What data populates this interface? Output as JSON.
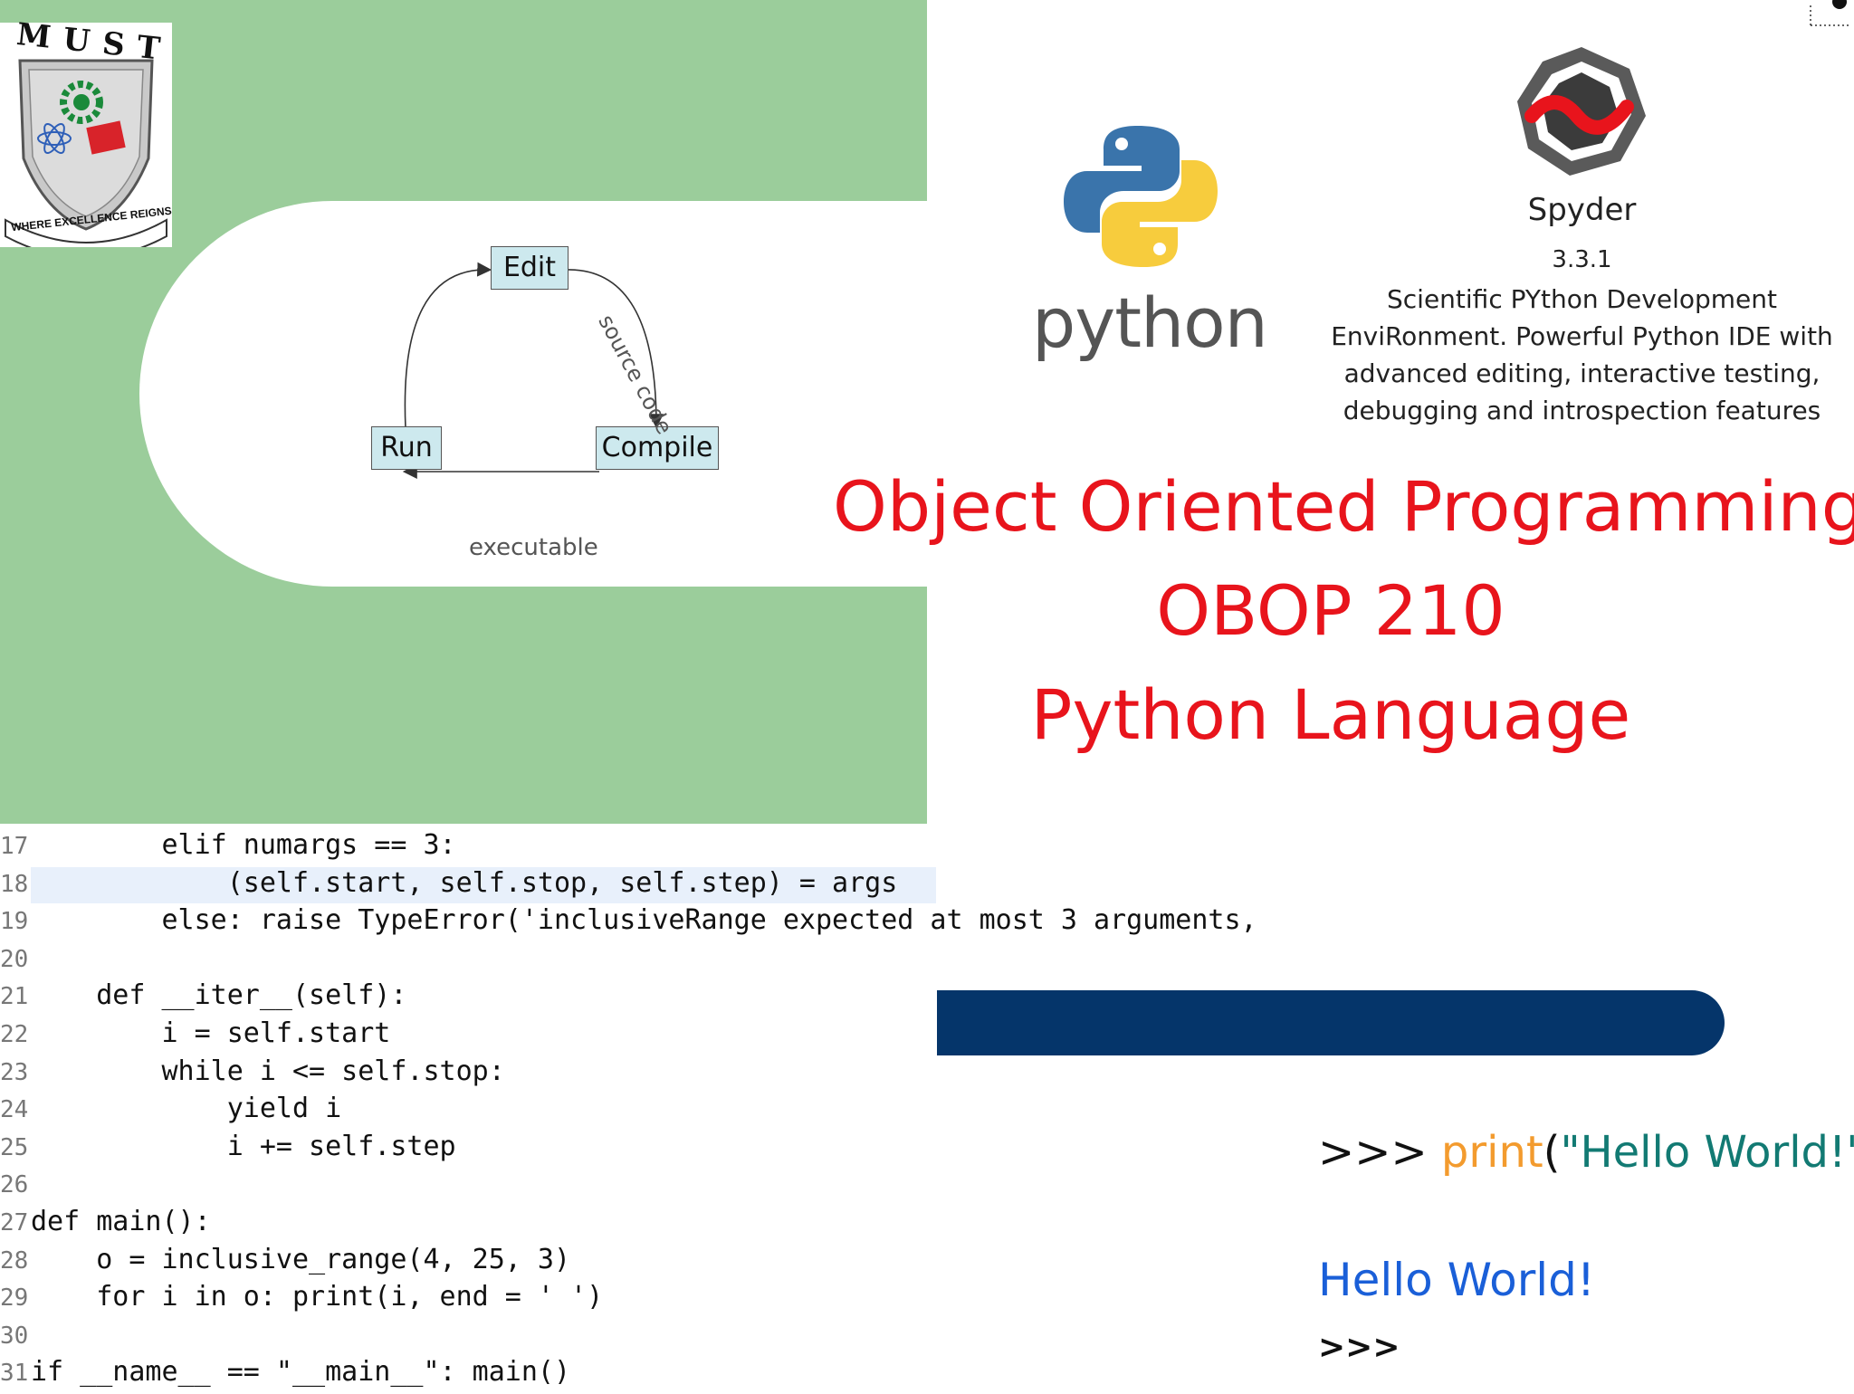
{
  "logo": {
    "name": "MUST",
    "motto": "WHERE EXCELLENCE REIGNS"
  },
  "diagram": {
    "nodes": {
      "edit": "Edit",
      "run": "Run",
      "compile": "Compile"
    },
    "edge_edit_compile": "source code",
    "edge_compile_run": "executable"
  },
  "python_logo": {
    "word": "python"
  },
  "spyder": {
    "name": "Spyder",
    "version": "3.3.1",
    "description": "Scientific PYthon Development EnviRonment. Powerful Python IDE with advanced editing, interactive testing, debugging and introspection features"
  },
  "title": {
    "line1": "Object Oriented Programming:",
    "line2": "OBOP 210",
    "line3": "Python Language",
    "color": "#e8141c"
  },
  "code": {
    "line_numbers": [
      "17",
      "18",
      "19",
      "20",
      "21",
      "22",
      "23",
      "24",
      "25",
      "26",
      "27",
      "28",
      "29",
      "30",
      "31"
    ],
    "lines": [
      "        elif numargs == 3:",
      "            (self.start, self.stop, self.step) = args",
      "        else: raise TypeError('inclusiveRange expected at most 3 arguments,",
      "",
      "    def __iter__(self):",
      "        i = self.start",
      "        while i <= self.stop:",
      "            yield i",
      "            i += self.step",
      "",
      "def main():",
      "    o = inclusive_range(4, 25, 3)",
      "    for i in o: print(i, end = ' ')",
      "",
      "if __name__ == \"__main__\": main()"
    ]
  },
  "repl": {
    "prompt": ">>>",
    "func": "print",
    "open": "(",
    "string": "\"Hello World!\"",
    "close": ")",
    "output": "Hello World!",
    "prompt2": ">>>"
  },
  "colors": {
    "green_panel": "#9bcd9b",
    "blue_bar": "#05356a",
    "python_blue": "#3a74ab",
    "python_yellow": "#f7cc3d"
  }
}
